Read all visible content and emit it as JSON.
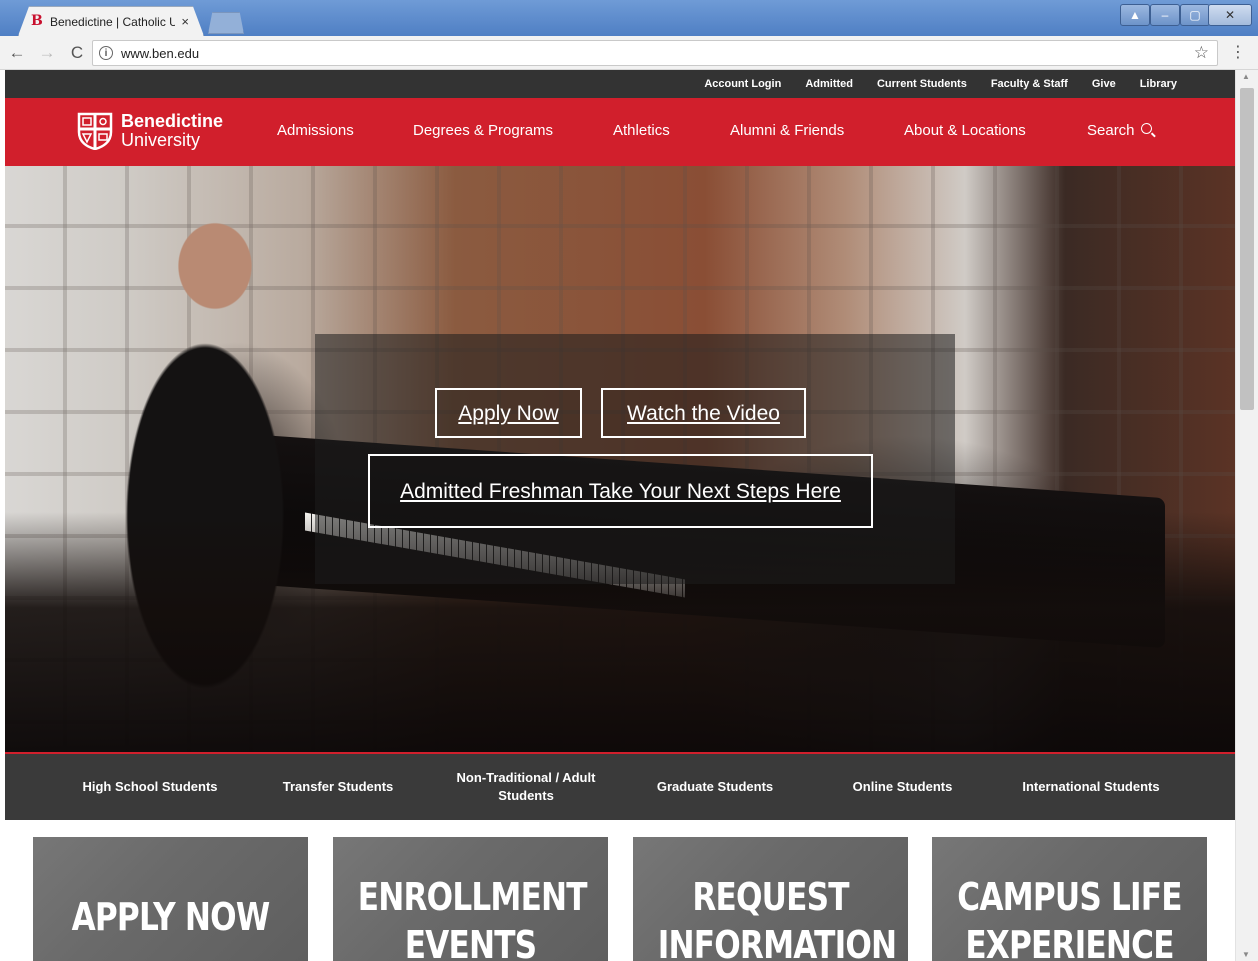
{
  "browser": {
    "tab_title": "Benedictine | Catholic Un",
    "tab_close": "×",
    "favicon": "B",
    "url": "www.ben.edu",
    "info_icon": "i",
    "star_icon": "☆",
    "menu_icon": "⋮",
    "back_icon": "←",
    "forward_icon": "→",
    "reload_icon": "C"
  },
  "utility_nav": [
    "Account Login",
    "Admitted",
    "Current Students",
    "Faculty & Staff",
    "Give",
    "Library"
  ],
  "logo": {
    "line1": "Benedictine",
    "line2": "University"
  },
  "main_nav": {
    "admissions": "Admissions",
    "degrees": "Degrees & Programs",
    "athletics": "Athletics",
    "alumni": "Alumni & Friends",
    "about": "About & Locations",
    "search": "Search"
  },
  "hero": {
    "apply": "Apply Now",
    "video": "Watch the Video",
    "admitted": "Admitted Freshman Take Your Next Steps Here"
  },
  "audience": {
    "high_school": "High School Students",
    "transfer": "Transfer Students",
    "adult": "Non-Traditional / Adult Students",
    "graduate": "Graduate Students",
    "online": "Online Students",
    "international": "International Students"
  },
  "tiles": {
    "apply": "APPLY NOW",
    "events": "ENROLLMENT EVENTS",
    "info": "REQUEST INFORMATION",
    "campus": "CAMPUS LIFE EXPERIENCE"
  },
  "colors": {
    "brand_red": "#d11f2c",
    "utility_bg": "#333333",
    "audience_bg": "#3a3a3a"
  }
}
